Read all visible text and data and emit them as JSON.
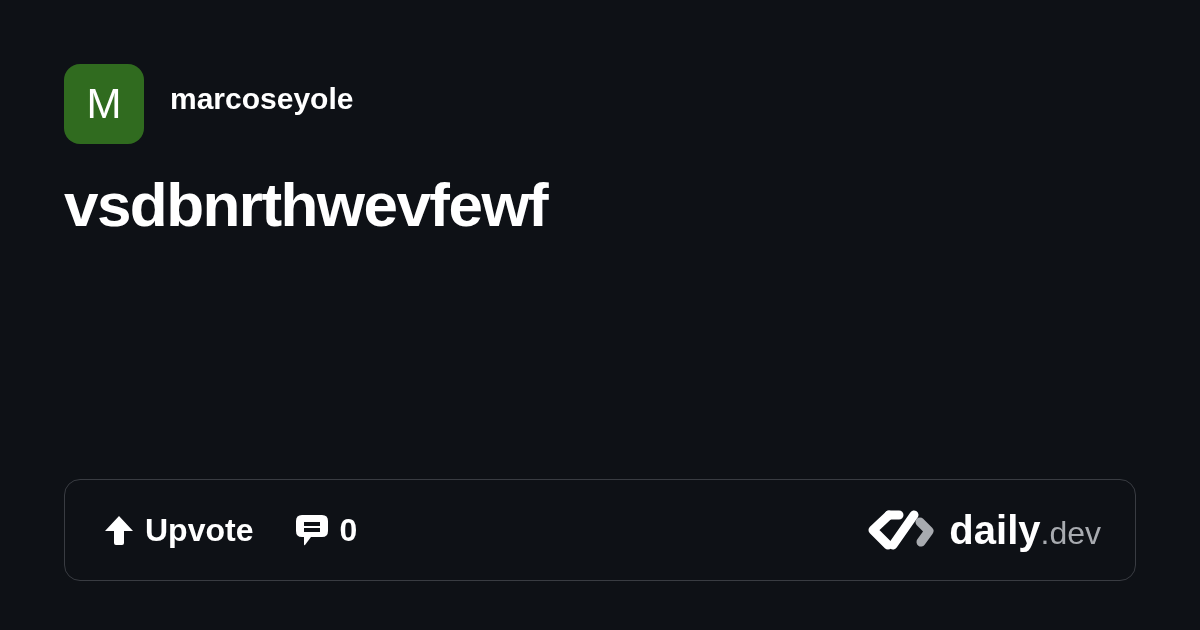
{
  "author": {
    "initial": "M",
    "name": "marcoseyole"
  },
  "post": {
    "title": "vsdbnrthwevfewf"
  },
  "actions": {
    "upvote_label": "Upvote",
    "comment_count": "0"
  },
  "logo": {
    "wordmark": "daily",
    "suffix": ".dev"
  }
}
